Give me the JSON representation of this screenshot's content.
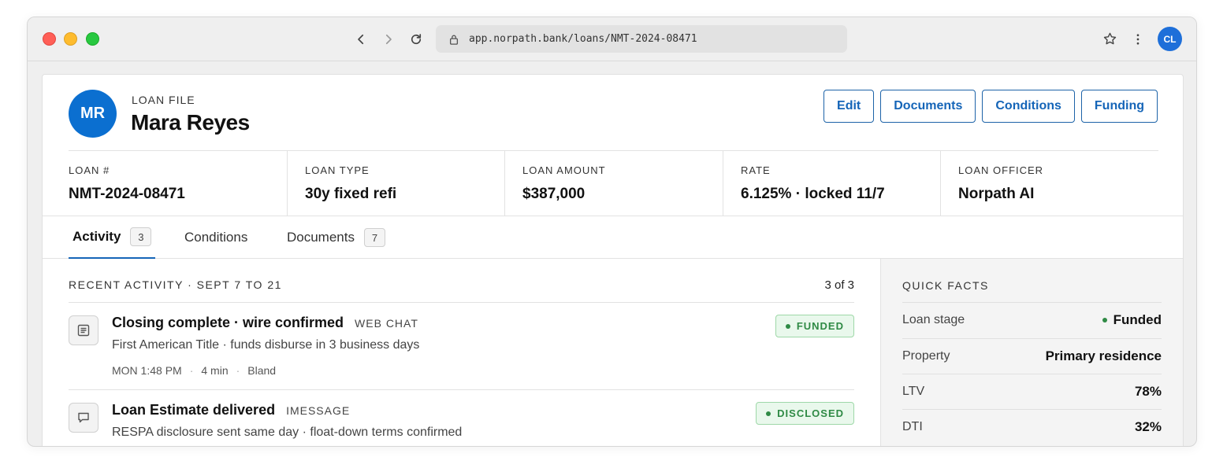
{
  "browser": {
    "url": "app.norpath.bank/loans/NMT-2024-08471",
    "profile_initials": "CL"
  },
  "header": {
    "avatar_initials": "MR",
    "eyebrow": "LOAN FILE",
    "name": "Mara Reyes",
    "actions": [
      "Edit",
      "Documents",
      "Conditions",
      "Funding"
    ]
  },
  "summary": [
    {
      "label": "LOAN #",
      "value": "NMT-2024-08471"
    },
    {
      "label": "LOAN TYPE",
      "value": "30y fixed refi"
    },
    {
      "label": "LOAN AMOUNT",
      "value": "$387,000"
    },
    {
      "label": "RATE",
      "value": "6.125% · locked 11/7"
    },
    {
      "label": "LOAN OFFICER",
      "value": "Norpath AI"
    }
  ],
  "tabs": [
    {
      "label": "Activity",
      "count": "3",
      "active": true
    },
    {
      "label": "Conditions",
      "count": "",
      "active": false
    },
    {
      "label": "Documents",
      "count": "7",
      "active": false
    }
  ],
  "activity": {
    "heading": "RECENT ACTIVITY · SEPT 7 TO 21",
    "pager": "3 of 3",
    "items": [
      {
        "icon": "document-icon",
        "title": "Closing complete · wire confirmed",
        "channel": "WEB CHAT",
        "description": "First American Title · funds disburse in 3 business days",
        "time": "MON 1:48 PM",
        "duration": "4 min",
        "agent": "Bland",
        "badge": "FUNDED"
      },
      {
        "icon": "chat-bubble-icon",
        "title": "Loan Estimate delivered",
        "channel": "IMESSAGE",
        "description": "RESPA disclosure sent same day · float-down terms confirmed",
        "badge": "DISCLOSED"
      }
    ]
  },
  "quick_facts": {
    "title": "QUICK FACTS",
    "rows": [
      {
        "key": "Loan stage",
        "value": "Funded",
        "status_dot": true
      },
      {
        "key": "Property",
        "value": "Primary residence"
      },
      {
        "key": "LTV",
        "value": "78%"
      },
      {
        "key": "DTI",
        "value": "32%"
      }
    ]
  },
  "colors": {
    "accent": "#1565b8",
    "status_green": "#2f8a45"
  }
}
